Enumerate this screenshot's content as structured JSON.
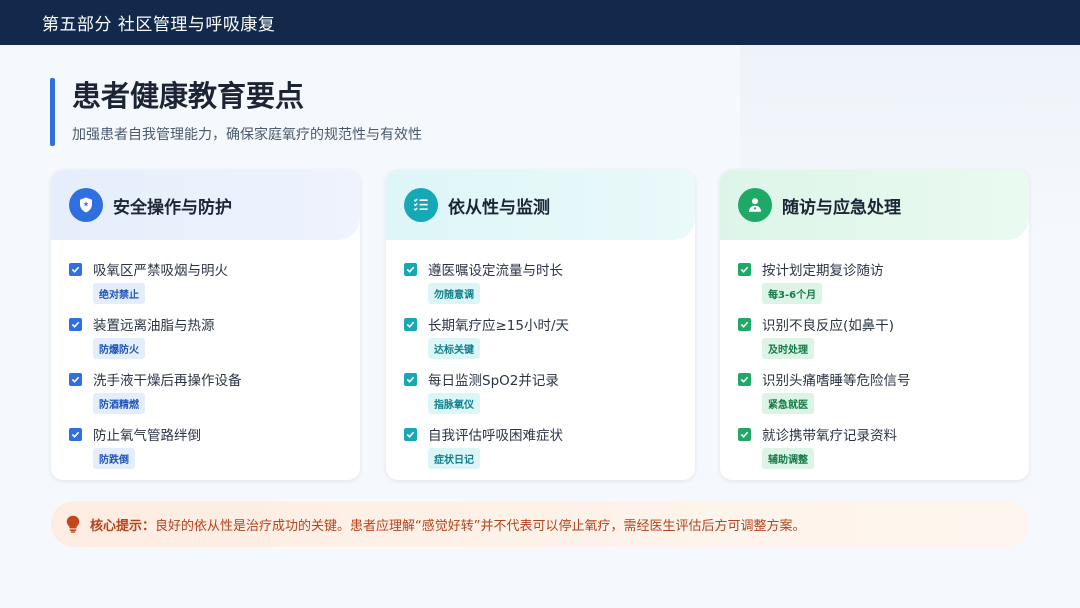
{
  "header": {
    "title": "第五部分 社区管理与呼吸康复"
  },
  "heading": {
    "title": "患者健康教育要点",
    "subtitle": "加强患者自我管理能力，确保家庭氧疗的规范性与有效性"
  },
  "cards": [
    {
      "title": "安全操作与防护",
      "icon": "shield-icon",
      "color": "#2f6fe0",
      "items": [
        {
          "text": "吸氧区严禁吸烟与明火",
          "tag": "绝对禁止"
        },
        {
          "text": "装置远离油脂与热源",
          "tag": "防爆防火"
        },
        {
          "text": "洗手液干燥后再操作设备",
          "tag": "防酒精燃"
        },
        {
          "text": "防止氧气管路绊倒",
          "tag": "防跌倒"
        }
      ]
    },
    {
      "title": "依从性与监测",
      "icon": "checklist-icon",
      "color": "#17a8b8",
      "items": [
        {
          "text": "遵医嘱设定流量与时长",
          "tag": "勿随意调"
        },
        {
          "text": "长期氧疗应≥15小时/天",
          "tag": "达标关键"
        },
        {
          "text": "每日监测SpO2并记录",
          "tag": "指脉氧仪"
        },
        {
          "text": "自我评估呼吸困难症状",
          "tag": "症状日记"
        }
      ]
    },
    {
      "title": "随访与应急处理",
      "icon": "doctor-icon",
      "color": "#1fa866",
      "items": [
        {
          "text": "按计划定期复诊随访",
          "tag": "每3-6个月"
        },
        {
          "text": "识别不良反应(如鼻干)",
          "tag": "及时处理"
        },
        {
          "text": "识别头痛嗜睡等危险信号",
          "tag": "紧急就医"
        },
        {
          "text": "就诊携带氧疗记录资料",
          "tag": "辅助调整"
        }
      ]
    }
  ],
  "tip": {
    "icon": "lightbulb-icon",
    "label": "核心提示：",
    "text": "良好的依从性是治疗成功的关键。患者应理解“感觉好转”并不代表可以停止氧疗，需经医生评估后方可调整方案。"
  }
}
